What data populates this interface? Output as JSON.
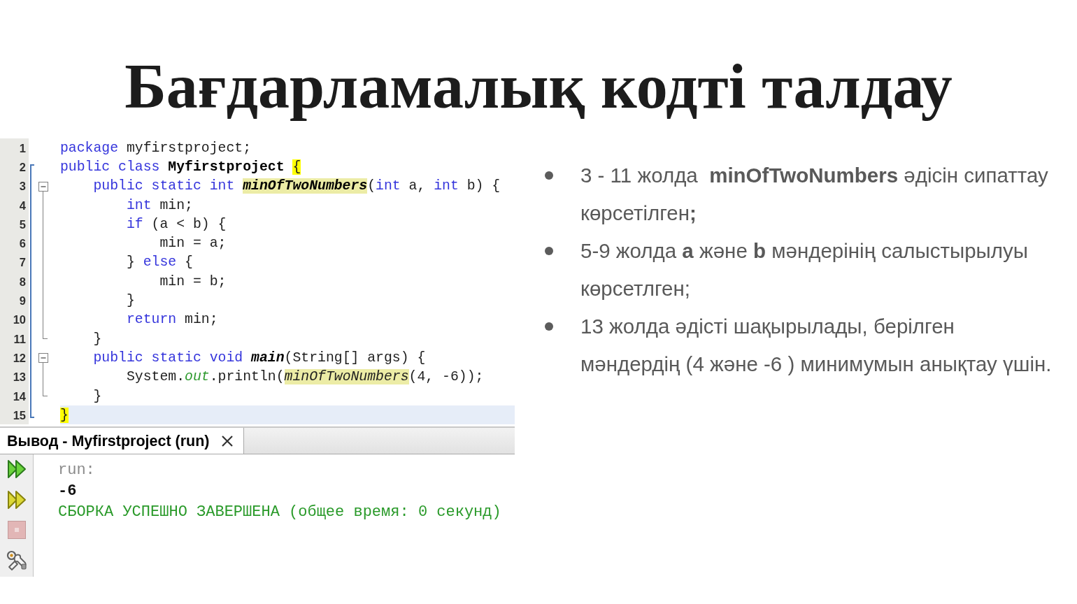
{
  "title": "Бағдарламалық кодті талдау",
  "editor": {
    "lines": [
      {
        "number": "1",
        "current": false,
        "in_scope": false,
        "fold_body": false,
        "tokens": [
          {
            "text": "package",
            "kind": "keyword"
          },
          {
            "text": " myfirstproject;",
            "kind": "plain"
          }
        ]
      },
      {
        "number": "2",
        "current": false,
        "in_scope": true,
        "fold_body": false,
        "tokens": [
          {
            "text": "public ",
            "kind": "keyword"
          },
          {
            "text": "class ",
            "kind": "keyword"
          },
          {
            "text": "Myfirstproject ",
            "kind": "class"
          },
          {
            "text": "{",
            "kind": "brace"
          }
        ]
      },
      {
        "number": "3",
        "current": false,
        "in_scope": true,
        "fold_body": false,
        "expanded": true,
        "tokens": [
          {
            "text": "    public ",
            "kind": "keyword"
          },
          {
            "text": "static ",
            "kind": "keyword"
          },
          {
            "text": "int ",
            "kind": "keyword"
          },
          {
            "text": "minOfTwoNumbers",
            "kind": "method_def"
          },
          {
            "text": "(",
            "kind": "plain"
          },
          {
            "text": "int",
            "kind": "keyword"
          },
          {
            "text": " a, ",
            "kind": "plain"
          },
          {
            "text": "int",
            "kind": "keyword"
          },
          {
            "text": " b) {",
            "kind": "plain"
          }
        ]
      },
      {
        "number": "4",
        "current": false,
        "in_scope": true,
        "fold_body": true,
        "tokens": [
          {
            "text": "        int",
            "kind": "keyword"
          },
          {
            "text": " min;",
            "kind": "plain"
          }
        ]
      },
      {
        "number": "5",
        "current": false,
        "in_scope": true,
        "fold_body": true,
        "tokens": [
          {
            "text": "        if",
            "kind": "keyword"
          },
          {
            "text": " (a < b) {",
            "kind": "plain"
          }
        ]
      },
      {
        "number": "6",
        "current": false,
        "in_scope": true,
        "fold_body": true,
        "tokens": [
          {
            "text": "            min = a;",
            "kind": "plain"
          }
        ]
      },
      {
        "number": "7",
        "current": false,
        "in_scope": true,
        "fold_body": true,
        "tokens": [
          {
            "text": "        } ",
            "kind": "plain"
          },
          {
            "text": "else",
            "kind": "keyword"
          },
          {
            "text": " {",
            "kind": "plain"
          }
        ]
      },
      {
        "number": "8",
        "current": false,
        "in_scope": true,
        "fold_body": true,
        "tokens": [
          {
            "text": "            min = b;",
            "kind": "plain"
          }
        ]
      },
      {
        "number": "9",
        "current": false,
        "in_scope": true,
        "fold_body": true,
        "tokens": [
          {
            "text": "        }",
            "kind": "plain"
          }
        ]
      },
      {
        "number": "10",
        "current": false,
        "in_scope": true,
        "fold_body": true,
        "tokens": [
          {
            "text": "        return",
            "kind": "keyword"
          },
          {
            "text": " min;",
            "kind": "plain"
          }
        ]
      },
      {
        "number": "11",
        "current": false,
        "in_scope": true,
        "fold_body": true,
        "tokens": [
          {
            "text": "    }",
            "kind": "plain"
          }
        ]
      },
      {
        "number": "12",
        "current": false,
        "in_scope": true,
        "fold_body": false,
        "expanded": true,
        "tokens": [
          {
            "text": "    public ",
            "kind": "keyword"
          },
          {
            "text": "static ",
            "kind": "keyword"
          },
          {
            "text": "void ",
            "kind": "keyword"
          },
          {
            "text": "main",
            "kind": "method_main"
          },
          {
            "text": "(String[] args) {",
            "kind": "plain"
          }
        ]
      },
      {
        "number": "13",
        "current": false,
        "in_scope": true,
        "fold_body": true,
        "tokens": [
          {
            "text": "        System.",
            "kind": "plain"
          },
          {
            "text": "out",
            "kind": "field"
          },
          {
            "text": ".println(",
            "kind": "plain"
          },
          {
            "text": "minOfTwoNumbers",
            "kind": "method_ref"
          },
          {
            "text": "(4, -6));",
            "kind": "plain"
          }
        ]
      },
      {
        "number": "14",
        "current": false,
        "in_scope": true,
        "fold_body": true,
        "tokens": [
          {
            "text": "    }",
            "kind": "plain"
          }
        ]
      },
      {
        "number": "15",
        "current": true,
        "in_scope": true,
        "fold_body": false,
        "tokens": [
          {
            "text": "}",
            "kind": "brace"
          }
        ]
      }
    ]
  },
  "output": {
    "tab": {
      "label": "Вывод - Myfirstproject (run)",
      "selected": true
    },
    "toolbar": [
      {
        "kind": "run",
        "disabled": false
      },
      {
        "kind": "run_alt",
        "disabled": false
      },
      {
        "kind": "stop",
        "disabled": true
      },
      {
        "kind": "settings",
        "disabled": false
      }
    ],
    "lines": [
      {
        "text": "run:",
        "kind": "status"
      },
      {
        "text": "-6",
        "kind": "result"
      },
      {
        "text": "СБОРКА УСПЕШНО ЗАВЕРШЕНА (общее время: 0 секунд)",
        "kind": "success"
      }
    ]
  },
  "bullets": [
    "3 - 11 жолда  **minOfTwoNumbers** әдісін сипаттау көрсетілген**;**",
    "5-9 жолда **a** және **b** мәндерінің салыстырылуы көрсетлген;",
    "13 жолда әдісті шақырылады, берілген мәндердің (4 және -6 ) минимумын анықтау үшін."
  ]
}
